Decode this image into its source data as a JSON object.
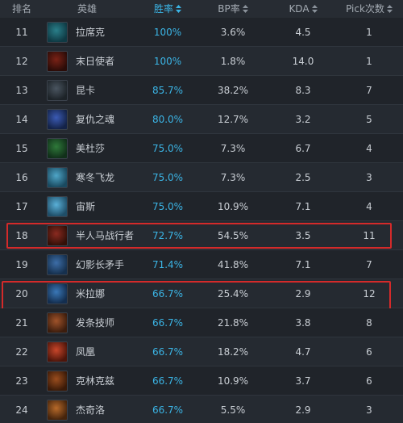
{
  "header": {
    "rank": "排名",
    "hero": "英雄",
    "winrate": "胜率",
    "bp": "BP率",
    "kda": "KDA",
    "pick": "Pick次数"
  },
  "colors": {
    "accent": "#3bb5e6",
    "highlight_border": "#d42a2a",
    "background": "#20242a"
  },
  "rows": [
    {
      "rank": "11",
      "hero": "拉席克",
      "winrate": "100%",
      "bp": "3.6%",
      "kda": "4.5",
      "pick": "1",
      "icon": "hero-portrait-icon",
      "highlighted": false
    },
    {
      "rank": "12",
      "hero": "末日使者",
      "winrate": "100%",
      "bp": "1.8%",
      "kda": "14.0",
      "pick": "1",
      "icon": "hero-portrait-icon",
      "highlighted": false
    },
    {
      "rank": "13",
      "hero": "昆卡",
      "winrate": "85.7%",
      "bp": "38.2%",
      "kda": "8.3",
      "pick": "7",
      "icon": "hero-portrait-icon",
      "highlighted": false
    },
    {
      "rank": "14",
      "hero": "复仇之魂",
      "winrate": "80.0%",
      "bp": "12.7%",
      "kda": "3.2",
      "pick": "5",
      "icon": "hero-portrait-icon",
      "highlighted": false
    },
    {
      "rank": "15",
      "hero": "美杜莎",
      "winrate": "75.0%",
      "bp": "7.3%",
      "kda": "6.7",
      "pick": "4",
      "icon": "hero-portrait-icon",
      "highlighted": false
    },
    {
      "rank": "16",
      "hero": "寒冬飞龙",
      "winrate": "75.0%",
      "bp": "7.3%",
      "kda": "2.5",
      "pick": "3",
      "icon": "hero-portrait-icon",
      "highlighted": false
    },
    {
      "rank": "17",
      "hero": "宙斯",
      "winrate": "75.0%",
      "bp": "10.9%",
      "kda": "7.1",
      "pick": "4",
      "icon": "hero-portrait-icon",
      "highlighted": false
    },
    {
      "rank": "18",
      "hero": "半人马战行者",
      "winrate": "72.7%",
      "bp": "54.5%",
      "kda": "3.5",
      "pick": "11",
      "icon": "hero-portrait-icon",
      "highlighted": true
    },
    {
      "rank": "19",
      "hero": "幻影长矛手",
      "winrate": "71.4%",
      "bp": "41.8%",
      "kda": "7.1",
      "pick": "7",
      "icon": "hero-portrait-icon",
      "highlighted": false
    },
    {
      "rank": "20",
      "hero": "米拉娜",
      "winrate": "66.7%",
      "bp": "25.4%",
      "kda": "2.9",
      "pick": "12",
      "icon": "hero-portrait-icon",
      "highlighted": true
    },
    {
      "rank": "21",
      "hero": "发条技师",
      "winrate": "66.7%",
      "bp": "21.8%",
      "kda": "3.8",
      "pick": "8",
      "icon": "hero-portrait-icon",
      "highlighted": false
    },
    {
      "rank": "22",
      "hero": "凤凰",
      "winrate": "66.7%",
      "bp": "18.2%",
      "kda": "4.7",
      "pick": "6",
      "icon": "hero-portrait-icon",
      "highlighted": false
    },
    {
      "rank": "23",
      "hero": "克林克兹",
      "winrate": "66.7%",
      "bp": "10.9%",
      "kda": "3.7",
      "pick": "6",
      "icon": "hero-portrait-icon",
      "highlighted": false
    },
    {
      "rank": "24",
      "hero": "杰奇洛",
      "winrate": "66.7%",
      "bp": "5.5%",
      "kda": "2.9",
      "pick": "3",
      "icon": "hero-portrait-icon",
      "highlighted": false
    }
  ]
}
